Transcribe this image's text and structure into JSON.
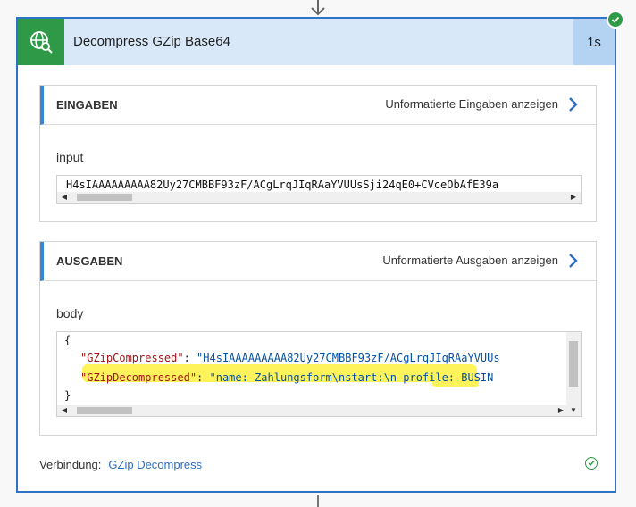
{
  "action": {
    "title": "Decompress GZip Base64",
    "duration": "1s",
    "status": "succeeded"
  },
  "inputs": {
    "section_label": "EINGABEN",
    "raw_link": "Unformatierte Eingaben anzeigen",
    "field_label": "input",
    "field_value": "H4sIAAAAAAAAA82Uy27CMBBF93zF/ACgLrqJIqRAaYVUUsSji24qE0+CVceObAfE39a"
  },
  "outputs": {
    "section_label": "AUSGABEN",
    "raw_link": "Unformatierte Ausgaben anzeigen",
    "field_label": "body",
    "open_brace": "{",
    "line1_key": "\"GZipCompressed\"",
    "line1_sep": ": ",
    "line1_value": "\"H4sIAAAAAAAAA82Uy27CMBBF93zF/ACgLrqJIqRAaYVUUs",
    "line2_key": "\"GZipDecompressed\"",
    "line2_sep": ": ",
    "line2_value": "\"name: Zahlungsform\\nstart:\\n  profile: BUSIN",
    "close_brace": "}"
  },
  "connection": {
    "label": "Verbindung:",
    "name": "GZip Decompress"
  },
  "colors": {
    "accent": "#2f73c7",
    "success": "#2e9a47",
    "highlight": "#fff35c"
  },
  "icons": {
    "action": "globe-search-icon",
    "expand": "chevron-right-icon",
    "status": "check-circle-icon"
  }
}
